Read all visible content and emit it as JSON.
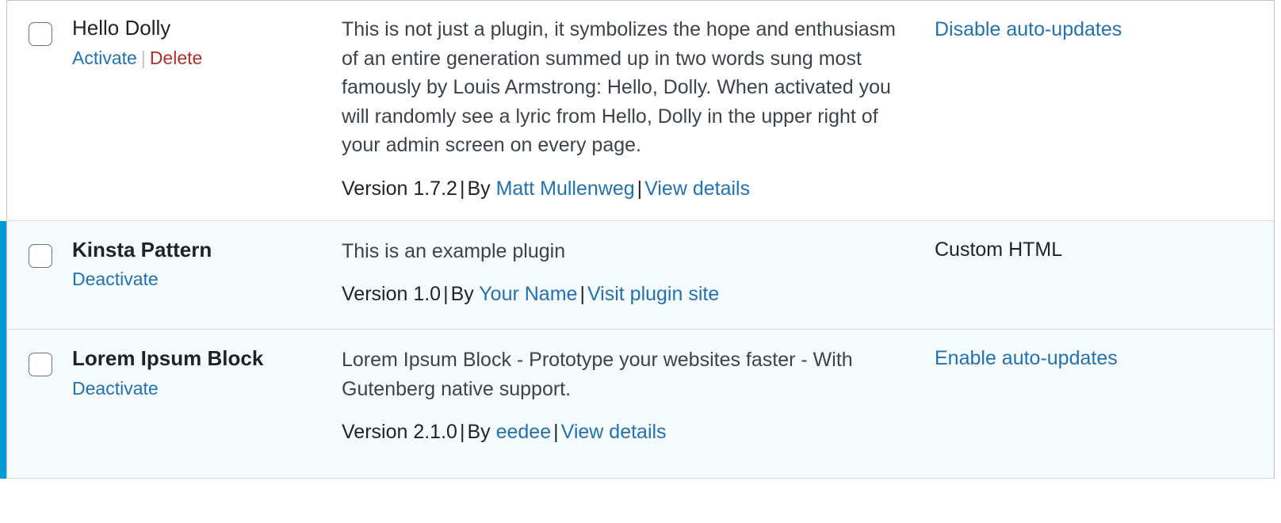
{
  "colors": {
    "link": "#2271b1",
    "delete": "#b32d2e",
    "active_accent": "#0099d4",
    "active_row_bg": "#f6fbfd",
    "border": "#dcdcde"
  },
  "plugins_table": {
    "rows": [
      {
        "id": "hello-dolly",
        "name": "Hello Dolly",
        "status": "inactive",
        "actions": [
          {
            "label": "Activate",
            "kind": "activate"
          },
          {
            "label": "Delete",
            "kind": "delete"
          }
        ],
        "action_separator": "|",
        "description": "This is not just a plugin, it symbolizes the hope and enthusiasm of an entire generation summed up in two words sung most famously by Louis Armstrong: Hello, Dolly. When activated you will randomly see a lyric from Hello, Dolly in the upper right of your admin screen on every page.",
        "meta": {
          "version": "Version 1.7.2",
          "separator_1": "|",
          "by_label": "By",
          "author": "Matt Mullenweg",
          "separator_2": "|",
          "details_link": "View details"
        },
        "auto_update": {
          "label": "Disable auto-updates",
          "is_link": true
        }
      },
      {
        "id": "kinsta-pattern",
        "name": "Kinsta Pattern",
        "status": "active",
        "actions": [
          {
            "label": "Deactivate",
            "kind": "deactivate"
          }
        ],
        "action_separator": "",
        "description": "This is an example plugin",
        "meta": {
          "version": "Version 1.0",
          "separator_1": "|",
          "by_label": "By",
          "author": "Your Name",
          "separator_2": "|",
          "details_link": "Visit plugin site"
        },
        "auto_update": {
          "label": "Custom HTML",
          "is_link": false
        }
      },
      {
        "id": "lorem-ipsum-block",
        "name": "Lorem Ipsum Block",
        "status": "active",
        "actions": [
          {
            "label": "Deactivate",
            "kind": "deactivate"
          }
        ],
        "action_separator": "",
        "description": "Lorem Ipsum Block - Prototype your websites faster - With Gutenberg native support.",
        "meta": {
          "version": "Version 2.1.0",
          "separator_1": "|",
          "by_label": "By",
          "author": "eedee",
          "separator_2": "|",
          "details_link": "View details"
        },
        "auto_update": {
          "label": "Enable auto-updates",
          "is_link": true
        }
      }
    ]
  }
}
